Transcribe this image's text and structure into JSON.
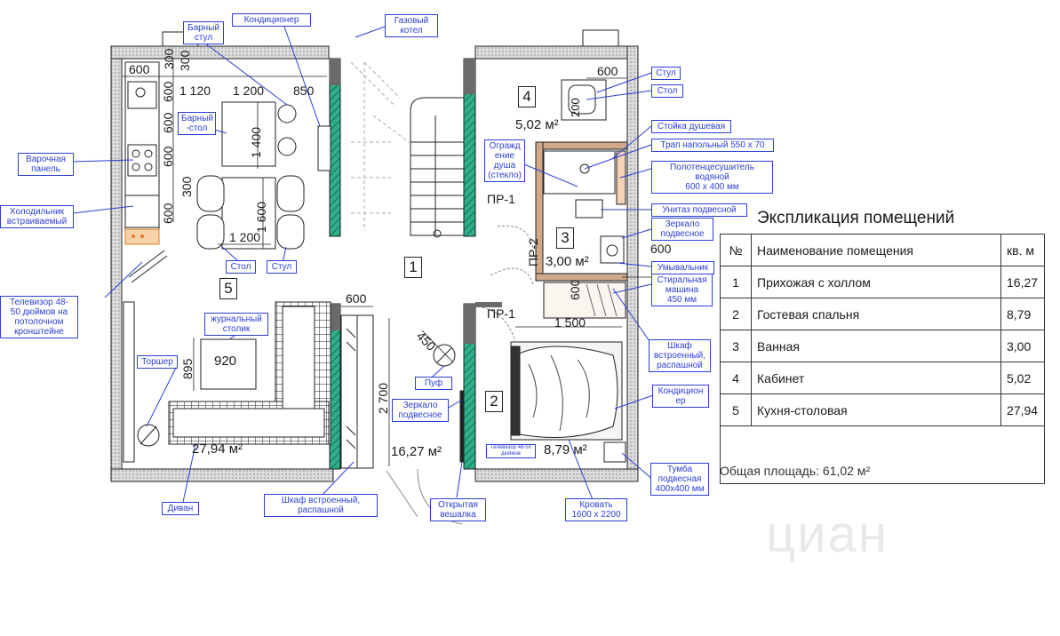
{
  "dims": {
    "d600a": "600",
    "d300a": "300",
    "d300b": "300",
    "d1120": "1 120",
    "d1200a": "1 200",
    "d850": "850",
    "d600b": "600",
    "d600c": "600",
    "d600d": "600",
    "d300c": "300",
    "d600e": "600",
    "d1400": "1 400",
    "d1600": "1 600",
    "d1200b": "1 200",
    "d600f": "600",
    "d600g": "600",
    "d600h": "600",
    "d600i": "600",
    "d200": "200",
    "d1500": "1 500",
    "d450": "450",
    "d2700": "2 700",
    "d895": "895",
    "d920": "920"
  },
  "rooms": {
    "r1": "1",
    "r2": "2",
    "r3": "3",
    "r4": "4",
    "r5": "5",
    "a1": "16,27 м²",
    "a2": "8,79 м²",
    "a3": "3,00 м²",
    "a4": "5,02 м²",
    "a5": "27,94 м²"
  },
  "doors": {
    "pr1a": "ПР-1",
    "pr1b": "ПР-1",
    "pr2": "ПР-2"
  },
  "notes": {
    "bar_chair": "Барный\nстул",
    "ac_top": "Кондиционер",
    "boiler": "Газовый\nкотел",
    "bar_table": "Барный\n-стол",
    "chair_top": "Стул",
    "table_top": "Стол",
    "shower_rack": "Стойка душевая",
    "floor_drain": "Трап напольный 550 х 70",
    "towel_dryer": "Полотенцесушитель\nводяной\n600 х 400 мм",
    "toilet": "Унитаз подвесной",
    "mirror_bath": "Зеркало\nподвесное",
    "sink": "Умывальник",
    "washer": "Стиральная\nмашина\n450 мм",
    "shower_guard": "Огражд\nение\nдуша\n(стекло)",
    "hob": "Варочная\nпанель",
    "fridge": "Холодильник\nвстраиваемый",
    "tv_living": "Телевизор 48-\n50 дюймов на\nпотолочном\nкронштейне",
    "table_mid": "Стол",
    "chair_mid": "Стул",
    "coffee_table": "журнальный\nстолик",
    "floor_lamp": "Торшер",
    "sofa": "Диван",
    "wardrobe_hall": "Шкаф встроенный,\nраспашной",
    "hanger": "Открытая\nвешалка",
    "pouf": "Пуф",
    "mirror_hall": "Зеркало\nподвесное",
    "wardrobe_bed": "Шкаф\nвстроенный,\nраспашной",
    "ac_bed": "Кондицион\nер",
    "bed": "Кровать\n1600 х 2200",
    "nightstand": "Тумба\nподвесная\n400х400 мм",
    "tv_bed": "Телевизор 48-50\nдюймов"
  },
  "explication": {
    "title": "Экспликация помещений",
    "headers": [
      "№",
      "Наименование помещения",
      "кв. м"
    ],
    "rows": [
      [
        "1",
        "Прихожая с холлом",
        "16,27"
      ],
      [
        "2",
        "Гостевая спальня",
        "8,79"
      ],
      [
        "3",
        "Ванная",
        "3,00"
      ],
      [
        "4",
        "Кабинет",
        "5,02"
      ],
      [
        "5",
        "Кухня-столовая",
        "27,94"
      ]
    ],
    "total": "Общая площадь: 61,02 м²"
  },
  "watermark": "циан",
  "colors": {
    "wall": "#1a1a1a",
    "partition": "#6a6a6a",
    "glass": "#2fae8a",
    "callout": "#2b3fd6",
    "brick": "#e07a2a"
  }
}
